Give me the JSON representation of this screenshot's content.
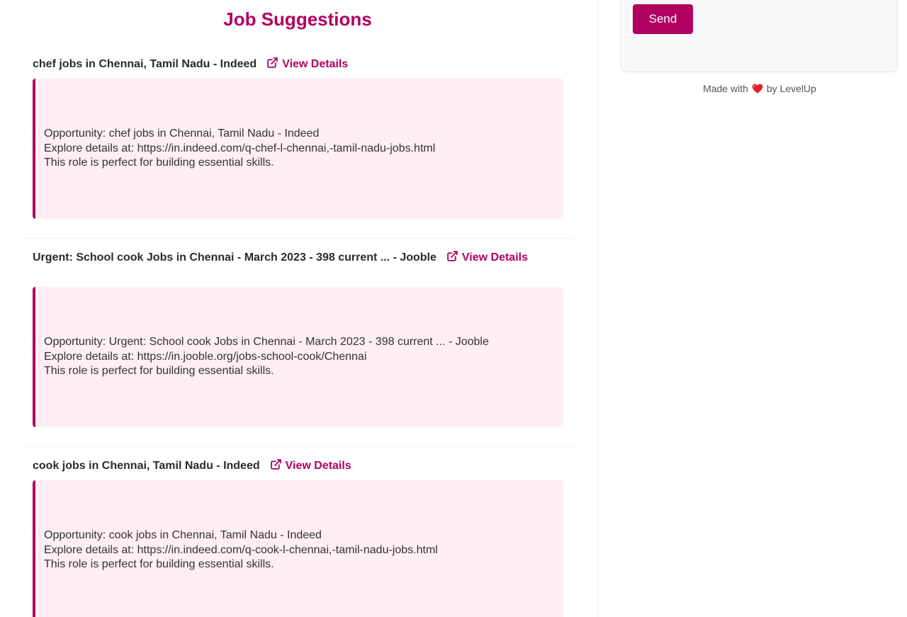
{
  "page_title": "Job Suggestions",
  "jobs": [
    {
      "title": "chef jobs in Chennai, Tamil Nadu - Indeed",
      "link_label": "View Details",
      "lines": [
        "Opportunity: chef jobs in Chennai, Tamil Nadu - Indeed",
        "Explore details at: https://in.indeed.com/q-chef-l-chennai,-tamil-nadu-jobs.html",
        "This role is perfect for building essential skills."
      ]
    },
    {
      "title": "Urgent: School cook Jobs in Chennai - March 2023 - 398 current ... - Jooble",
      "link_label": "View Details",
      "lines": [
        "Opportunity: Urgent: School cook Jobs in Chennai - March 2023 - 398 current ... - Jooble",
        "Explore details at: https://in.jooble.org/jobs-school-cook/Chennai",
        "This role is perfect for building essential skills."
      ]
    },
    {
      "title": "cook jobs in Chennai, Tamil Nadu - Indeed",
      "link_label": "View Details",
      "lines": [
        "Opportunity: cook jobs in Chennai, Tamil Nadu - Indeed",
        "Explore details at: https://in.indeed.com/q-cook-l-chennai,-tamil-nadu-jobs.html",
        "This role is perfect for building essential skills."
      ]
    }
  ],
  "chat": {
    "send_label": "Send"
  },
  "footer": {
    "made_with": "Made with",
    "by": "by LevelUp"
  },
  "icons": {
    "external_link": "external-link-icon",
    "heart": "heart-icon"
  },
  "colors": {
    "accent": "#b0005f",
    "card_bg": "#ffeef4",
    "heart": "#e0202a"
  }
}
